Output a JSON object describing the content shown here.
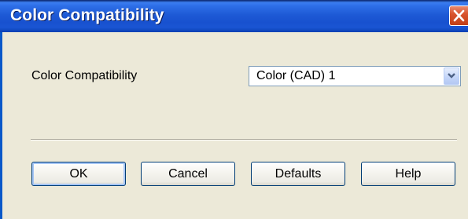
{
  "window": {
    "title": "Color Compatibility"
  },
  "form": {
    "label": "Color Compatibility",
    "selected_value": "Color (CAD) 1"
  },
  "buttons": {
    "ok": "OK",
    "cancel": "Cancel",
    "defaults": "Defaults",
    "help": "Help"
  },
  "icons": {
    "close": "close-icon",
    "dropdown": "chevron-down-icon"
  },
  "colors": {
    "titlebar": "#1e5ad6",
    "close_button": "#d9552e",
    "dialog_background": "#ece9d8"
  }
}
